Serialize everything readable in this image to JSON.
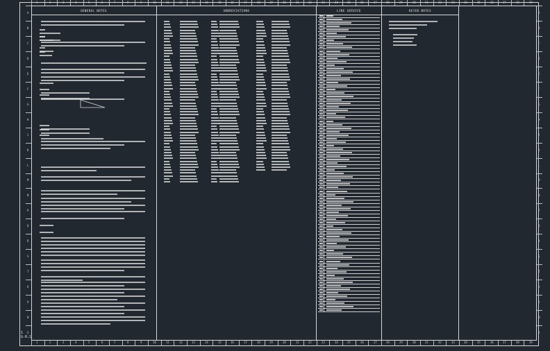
{
  "drawing": {
    "sheet_number": "G-0.1",
    "marker": "1"
  },
  "columns": {
    "general_notes_title": "GENERAL NOTES",
    "abbreviations_title": "ABBREVIATIONS",
    "symbols_title": "LINE SERVICE",
    "keyed_notes_title": "KEYED NOTES"
  },
  "ruler": {
    "top": [
      "1",
      "2",
      "3",
      "4",
      "5",
      "6",
      "7",
      "8",
      "9",
      "10",
      "11",
      "12",
      "13",
      "14",
      "15",
      "16",
      "17",
      "18",
      "19",
      "20",
      "21",
      "22",
      "23",
      "24",
      "25",
      "26",
      "27",
      "28",
      "29",
      "30",
      "31",
      "32",
      "33",
      "34",
      "35",
      "36",
      "37",
      "38",
      "39"
    ],
    "side": [
      "A",
      "B",
      "C",
      "D",
      "E",
      "F",
      "G",
      "H",
      "J",
      "K",
      "L",
      "M",
      "N",
      "P",
      "Q",
      "R",
      "S",
      "T",
      "U",
      "V",
      "W",
      "X"
    ]
  },
  "colors": {
    "background": "#212830",
    "linework": "#d8d8d8"
  }
}
